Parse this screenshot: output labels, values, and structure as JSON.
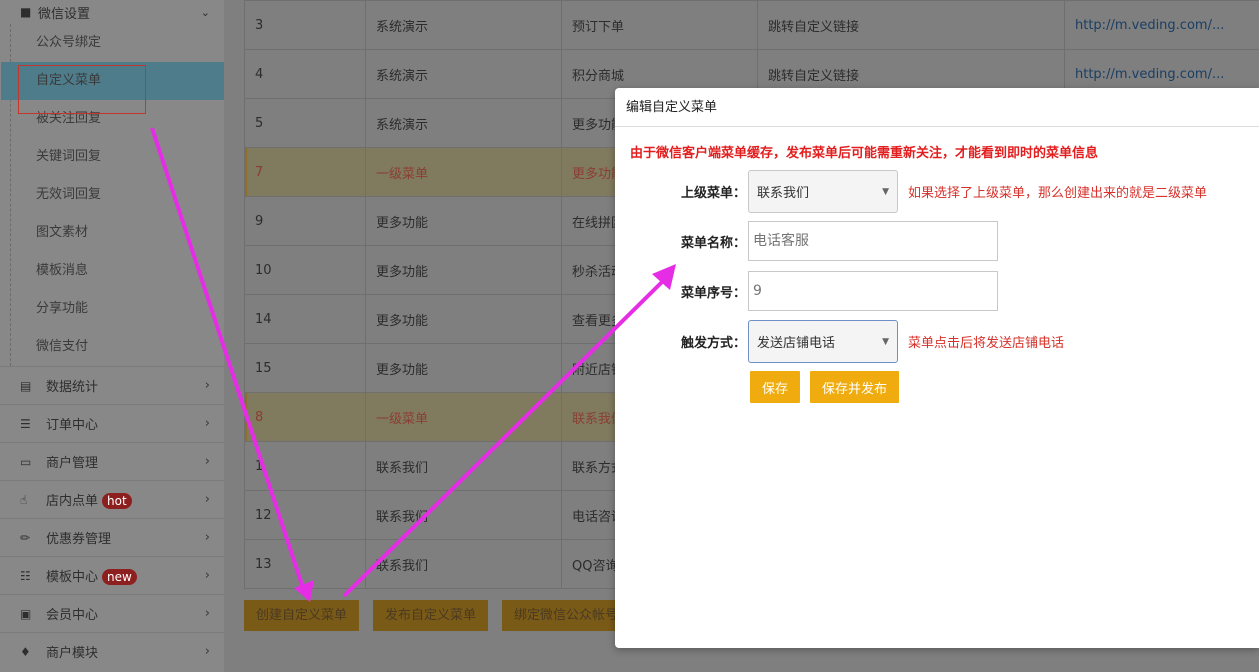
{
  "sidebar": {
    "group": {
      "icon": "chat-icon",
      "label": "微信设置"
    },
    "submenu": [
      "公众号绑定",
      "自定义菜单",
      "被关注回复",
      "关键词回复",
      "无效词回复",
      "图文素材",
      "模板消息",
      "分享功能",
      "微信支付"
    ],
    "active_submenu": "自定义菜单",
    "items": [
      {
        "icon": "bar-chart-icon",
        "label": "数据统计"
      },
      {
        "icon": "list-icon",
        "label": "订单中心"
      },
      {
        "icon": "laptop-icon",
        "label": "商户管理"
      },
      {
        "icon": "hand-pointer-icon",
        "label": "店内点单",
        "badge": "hot"
      },
      {
        "icon": "eraser-icon",
        "label": "优惠券管理"
      },
      {
        "icon": "th-list-icon",
        "label": "模板中心",
        "badge": "new"
      },
      {
        "icon": "credit-card-icon",
        "label": "会员中心"
      },
      {
        "icon": "gift-icon",
        "label": "商户模块"
      }
    ]
  },
  "table": {
    "rows": [
      {
        "id": "3",
        "parent": "系统演示",
        "name": "预订下单",
        "action": "跳转自定义链接",
        "link": "http://m.veding.com/..."
      },
      {
        "id": "4",
        "parent": "系统演示",
        "name": "积分商城",
        "action": "跳转自定义链接",
        "link": "http://m.veding.com/..."
      },
      {
        "id": "5",
        "parent": "系统演示",
        "name": "更多功能",
        "action": "",
        "link": ""
      },
      {
        "id": "7",
        "parent": "一级菜单",
        "name": "更多功能",
        "action": "",
        "link": ""
      },
      {
        "id": "9",
        "parent": "更多功能",
        "name": "在线拼团",
        "action": "",
        "link": ""
      },
      {
        "id": "10",
        "parent": "更多功能",
        "name": "秒杀活动",
        "action": "",
        "link": ""
      },
      {
        "id": "14",
        "parent": "更多功能",
        "name": "查看更多",
        "action": "",
        "link": ""
      },
      {
        "id": "15",
        "parent": "更多功能",
        "name": "附近店铺",
        "action": "",
        "link": ""
      },
      {
        "id": "8",
        "parent": "一级菜单",
        "name": "联系我们",
        "action": "",
        "link": ""
      },
      {
        "id": "1",
        "parent": "联系我们",
        "name": "联系方式",
        "action": "",
        "link": ""
      },
      {
        "id": "12",
        "parent": "联系我们",
        "name": "电话咨询",
        "action": "",
        "link": ""
      },
      {
        "id": "13",
        "parent": "联系我们",
        "name": "QQ咨询",
        "action": "",
        "link": ""
      }
    ]
  },
  "bottom_buttons": {
    "create": "创建自定义菜单",
    "publish": "发布自定义菜单",
    "bind": "绑定微信公众帐号"
  },
  "modal": {
    "title": "编辑自定义菜单",
    "notice": "由于微信客户端菜单缓存，发布菜单后可能需重新关注，才能看到即时的菜单信息",
    "parent_label": "上级菜单：",
    "parent_value": "联系我们",
    "parent_hint": "如果选择了上级菜单，那么创建出来的就是二级菜单",
    "name_label": "菜单名称：",
    "name_value": "电话客服",
    "order_label": "菜单序号：",
    "order_value": "9",
    "trigger_label": "触发方式：",
    "trigger_value": "发送店铺电话",
    "trigger_hint": "菜单点击后将发送店铺电话",
    "save": "保存",
    "save_publish": "保存并发布"
  },
  "colors": {
    "accent": "#f0ac0e",
    "hint_red": "#d6312a",
    "annotation": "#e62de6",
    "active_frame": "#c1372d"
  }
}
